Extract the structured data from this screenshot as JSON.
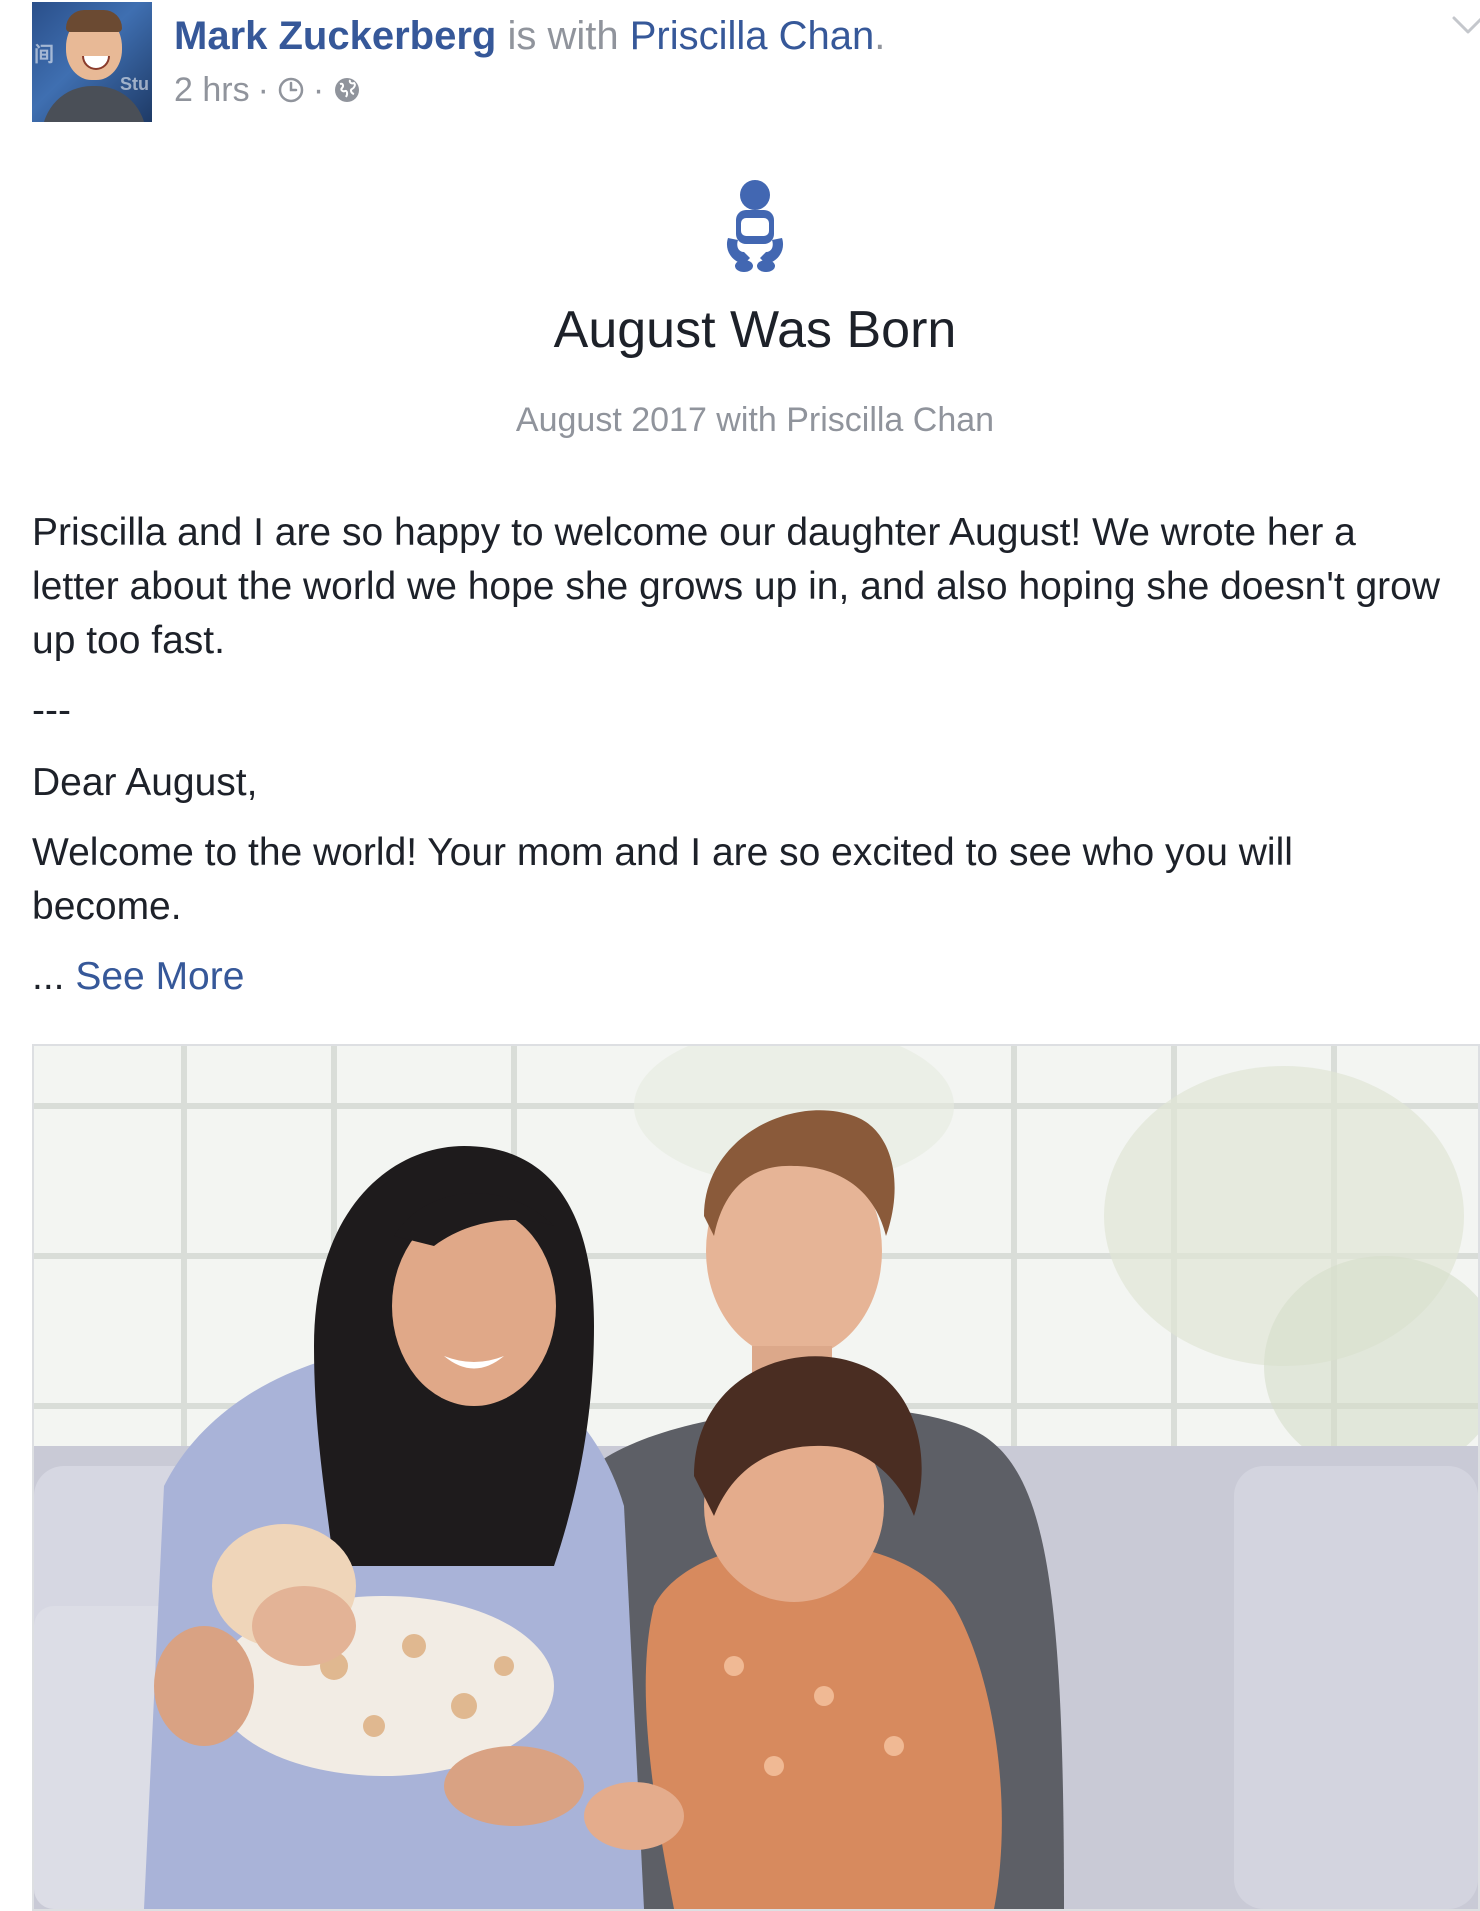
{
  "post": {
    "author": "Mark Zuckerberg",
    "with_text": " is with ",
    "tagged": "Priscilla Chan",
    "period": ".",
    "timestamp": "2 hrs",
    "separator": "·",
    "icons": [
      "clock-icon",
      "globe-icon",
      "chevron-down-icon"
    ],
    "avatar_icon": "profile-photo"
  },
  "life_event": {
    "icon": "baby-icon",
    "title": "August Was Born",
    "subtitle": "August 2017 with Priscilla Chan"
  },
  "body": {
    "paragraph_1": "Priscilla and I are so happy to welcome our daughter August! We wrote her a letter about the world we hope she grows up in, and also hoping she doesn't grow up too fast.",
    "separator_line": "---",
    "salutation": "Dear August,",
    "paragraph_2": "Welcome to the world! Your mom and I are so excited to see who you will become.",
    "ellipsis": "... ",
    "see_more": "See More"
  },
  "photo": {
    "subject": "family-photo"
  },
  "colors": {
    "link": "#365899",
    "meta_gray": "#90949c",
    "text": "#1d2129",
    "event_icon": "#4267b2",
    "border": "#dddfe2"
  }
}
